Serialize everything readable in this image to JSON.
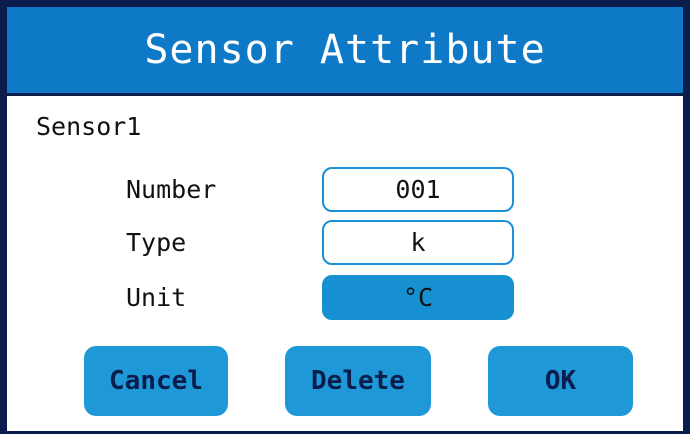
{
  "window": {
    "title": "Sensor Attribute"
  },
  "sensor": {
    "name": "Sensor1"
  },
  "fields": {
    "number": {
      "label": "Number",
      "value": "001"
    },
    "type": {
      "label": "Type",
      "value": "k"
    },
    "unit": {
      "label": "Unit",
      "value": "°C"
    }
  },
  "buttons": {
    "cancel": "Cancel",
    "delete": "Delete",
    "ok": "OK"
  },
  "colors": {
    "title_bar": "#0e7ac7",
    "frame": "#0b1d4d",
    "button": "#1e98d6",
    "field_border": "#1a90d8",
    "unit_fill": "#1790d2"
  }
}
